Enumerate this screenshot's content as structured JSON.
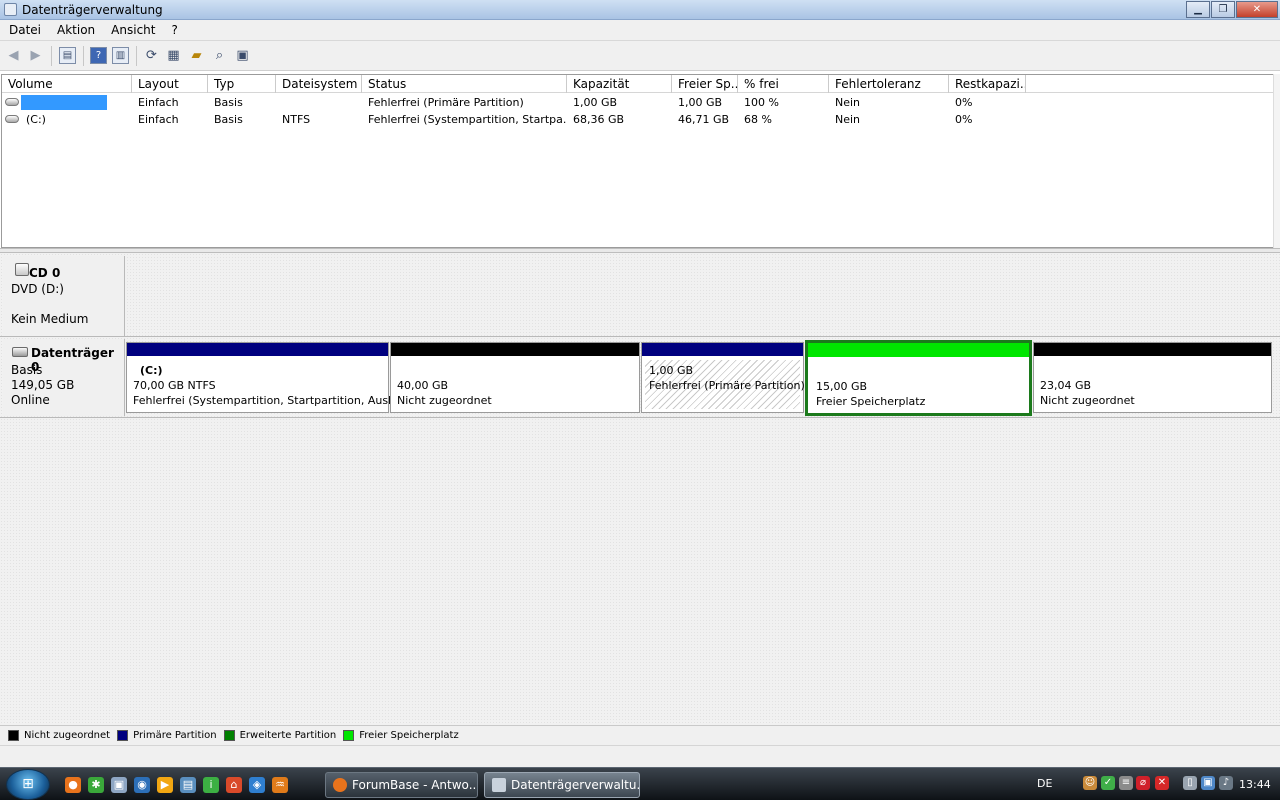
{
  "window": {
    "title": "Datenträgerverwaltung",
    "buttons": [
      "▁",
      "❐",
      "✕"
    ]
  },
  "menu": [
    "Datei",
    "Aktion",
    "Ansicht",
    "?"
  ],
  "volume_list": {
    "columns": [
      "Volume",
      "Layout",
      "Typ",
      "Dateisystem",
      "Status",
      "Kapazität",
      "Freier Sp...",
      "% frei",
      "Fehlertoleranz",
      "Restkapazi..."
    ],
    "rows": [
      {
        "volume": "",
        "layout": "Einfach",
        "typ": "Basis",
        "dateisystem": "",
        "status": "Fehlerfrei (Primäre Partition)",
        "kapazitaet": "1,00 GB",
        "frei": "1,00 GB",
        "prozent": "100 %",
        "fehlertoleranz": "Nein",
        "rest": "0%"
      },
      {
        "volume": "(C:)",
        "layout": "Einfach",
        "typ": "Basis",
        "dateisystem": "NTFS",
        "status": "Fehlerfrei (Systempartition, Startpa...",
        "kapazitaet": "68,36 GB",
        "frei": "46,71 GB",
        "prozent": "68 %",
        "fehlertoleranz": "Nein",
        "rest": "0%"
      }
    ]
  },
  "disks": {
    "cd0": {
      "name": "CD 0",
      "line1": "DVD (D:)",
      "line2": "Kein Medium"
    },
    "disk0": {
      "name": "Datenträger 0",
      "line1": "Basis",
      "line2": "149,05 GB",
      "line3": "Online",
      "partitions": [
        {
          "title": "(C:)",
          "size": "70,00 GB NTFS",
          "status": "Fehlerfrei (Systempartition, Startpartition, Ausla",
          "color": "#00007f"
        },
        {
          "title": "",
          "size": "40,00 GB",
          "status": "Nicht zugeordnet",
          "color": "#000000"
        },
        {
          "title": "",
          "size": "1,00 GB",
          "status": "Fehlerfrei (Primäre Partition)",
          "color": "#00007f"
        },
        {
          "title": "",
          "size": "15,00 GB",
          "status": "Freier Speicherplatz",
          "color": "#00e600"
        },
        {
          "title": "",
          "size": "23,04 GB",
          "status": "Nicht zugeordnet",
          "color": "#000000"
        }
      ]
    }
  },
  "legend": [
    {
      "label": "Nicht zugeordnet",
      "color": "#000000"
    },
    {
      "label": "Primäre Partition",
      "color": "#00007f"
    },
    {
      "label": "Erweiterte Partition",
      "color": "#008000"
    },
    {
      "label": "Freier Speicherplatz",
      "color": "#00e600"
    }
  ],
  "taskbar": {
    "tasks": [
      {
        "label": "ForumBase - Antwo...",
        "icon": "firefox-icon"
      },
      {
        "label": "Datenträgerverwaltu...",
        "icon": "disk-management-icon"
      }
    ],
    "language": "DE",
    "clock": "13:44"
  }
}
